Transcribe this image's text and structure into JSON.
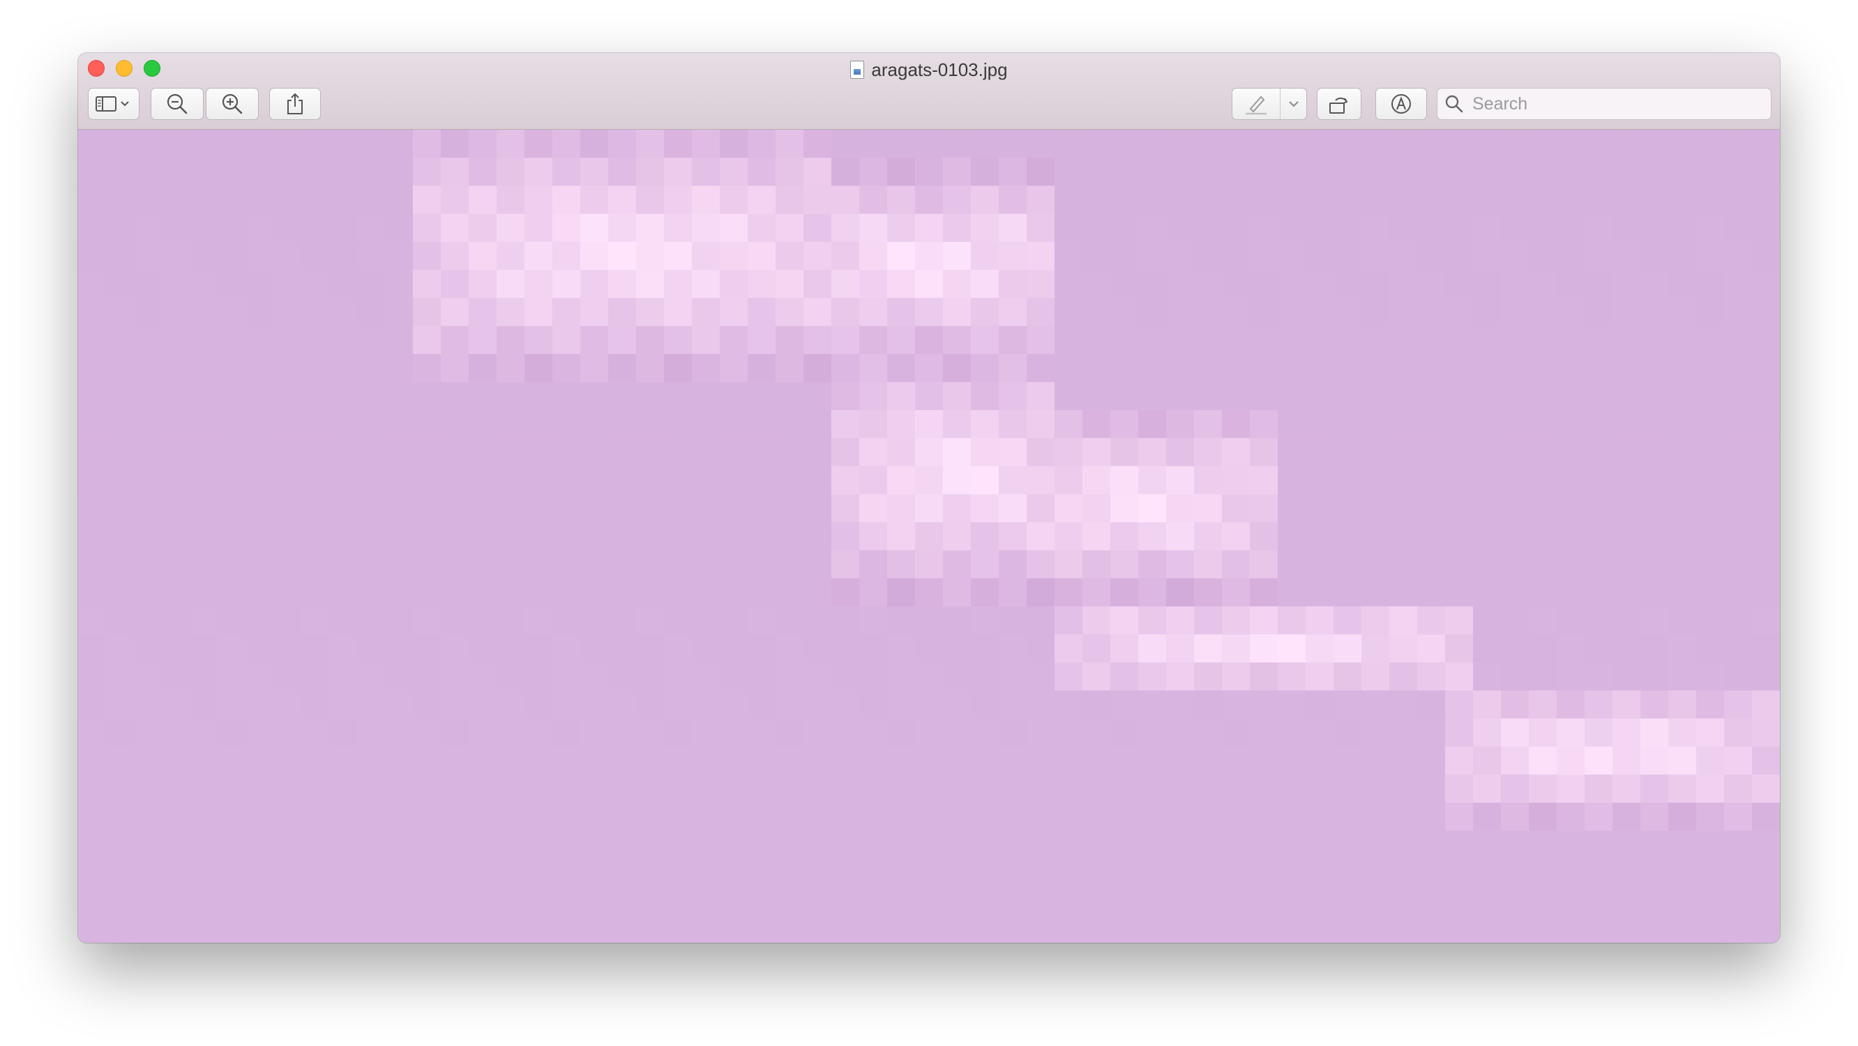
{
  "window": {
    "title": "aragats-0103.jpg"
  },
  "toolbar": {
    "sidebar_icon": "sidebar-icon",
    "zoom_out_icon": "zoom-out-icon",
    "zoom_in_icon": "zoom-in-icon",
    "share_icon": "share-icon",
    "markup_pen_icon": "pen-icon",
    "rotate_icon": "rotate-left-icon",
    "annotate_icon": "markup-icon"
  },
  "search": {
    "placeholder": "Search",
    "value": ""
  },
  "colors": {
    "close": "#fe5f57",
    "minimize": "#febc2e",
    "maximize": "#28c840",
    "image_base": "#d6b2de",
    "image_highlight": "#ffe3fb"
  }
}
